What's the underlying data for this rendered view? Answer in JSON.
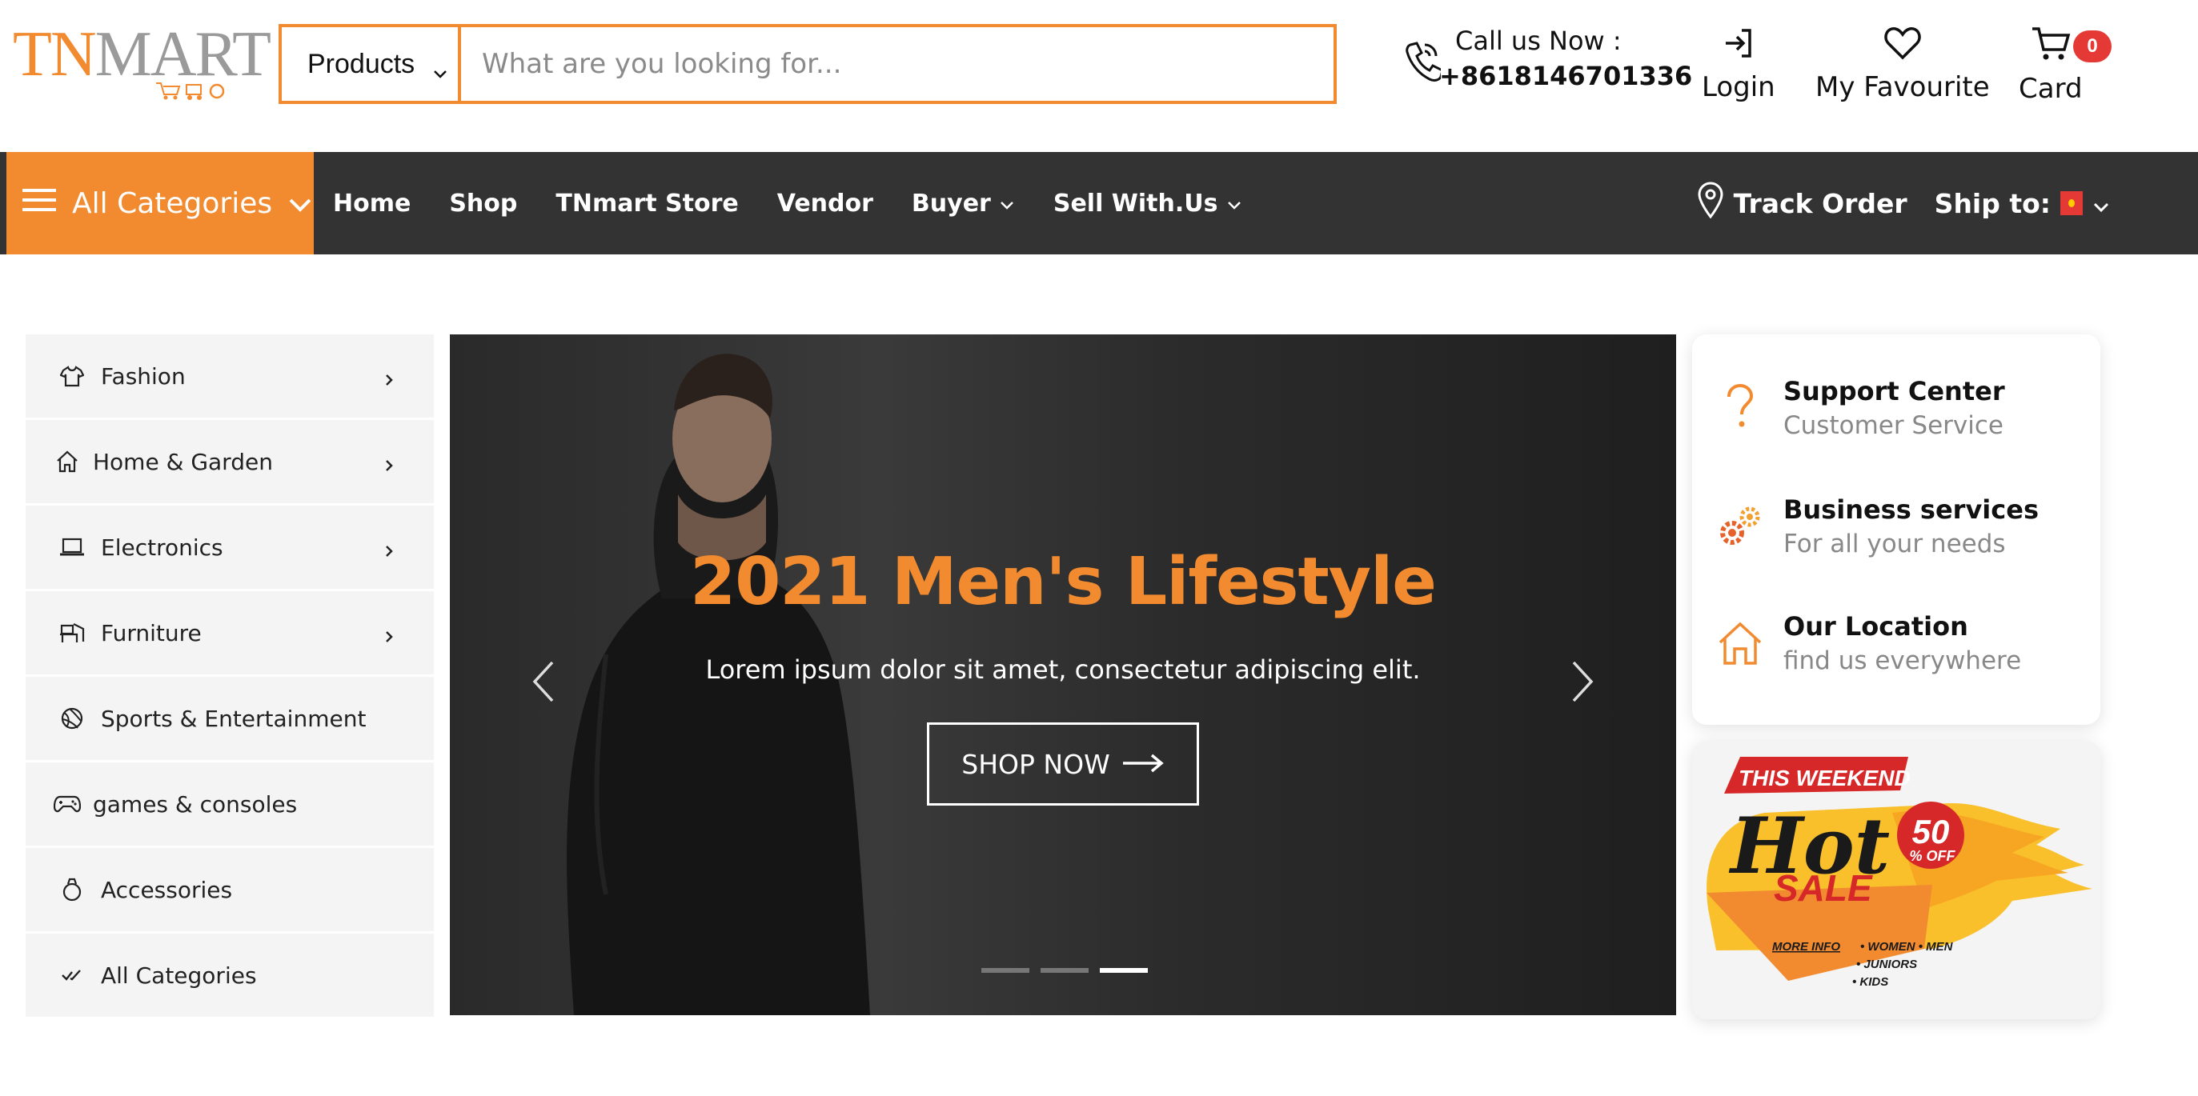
{
  "logo": {
    "part1": "TN",
    "part2": "MART"
  },
  "search": {
    "category": "Products",
    "placeholder": "What are you looking for..."
  },
  "contact": {
    "label": "Call us Now :",
    "number": "+8618146701336"
  },
  "header_actions": {
    "login": "Login",
    "favourite": "My Favourite",
    "cart": "Card",
    "cart_count": "0"
  },
  "nav": {
    "all_categories": "All Categories",
    "items": [
      "Home",
      "Shop",
      "TNmart Store",
      "Vendor",
      "Buyer",
      "Sell With.Us"
    ],
    "track_order": "Track Order",
    "ship_to": "Ship to:"
  },
  "sidebar": {
    "items": [
      {
        "label": "Fashion",
        "icon": "shirt-icon",
        "has_submenu": true
      },
      {
        "label": "Home & Garden",
        "icon": "home-icon",
        "has_submenu": true
      },
      {
        "label": "Electronics",
        "icon": "laptop-icon",
        "has_submenu": true
      },
      {
        "label": "Furniture",
        "icon": "furniture-icon",
        "has_submenu": true
      },
      {
        "label": "Sports & Entertainment",
        "icon": "ball-icon",
        "has_submenu": false
      },
      {
        "label": "games & consoles",
        "icon": "gamepad-icon",
        "has_submenu": false
      },
      {
        "label": "Accessories",
        "icon": "ring-icon",
        "has_submenu": false
      },
      {
        "label": "All Categories",
        "icon": "check-icon",
        "has_submenu": false
      }
    ]
  },
  "hero": {
    "title": "2021 Men's Lifestyle",
    "subtitle": "Lorem ipsum dolor sit amet, consectetur adipiscing elit.",
    "button": "SHOP NOW",
    "slide_count": 3,
    "active_slide": 3
  },
  "services": [
    {
      "title": "Support Center",
      "subtitle": "Customer Service",
      "icon": "question-icon"
    },
    {
      "title": "Business services",
      "subtitle": "For all your needs",
      "icon": "gears-icon"
    },
    {
      "title": "Our Location",
      "subtitle": "find us everywhere",
      "icon": "home-outline-icon"
    }
  ],
  "promo": {
    "banner": "THIS WEEKEND",
    "hot": "Hot",
    "sale": "SALE",
    "discount": "50",
    "discount_suffix": "% OFF",
    "more_info": "MORE INFO",
    "bullets": [
      "• WOMEN  • MEN",
      "• JUNIORS",
      "• KIDS"
    ]
  },
  "colors": {
    "accent": "#f28a30",
    "nav_bg": "#333333",
    "badge": "#e53935"
  }
}
